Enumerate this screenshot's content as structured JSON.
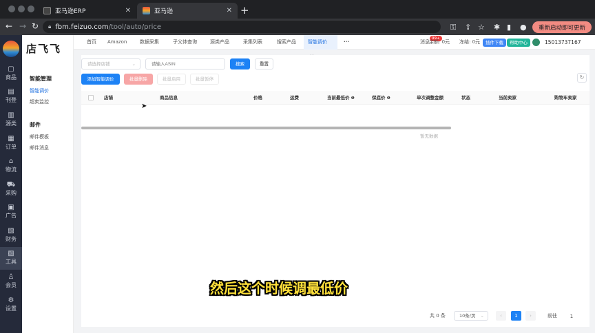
{
  "browser": {
    "tabs": [
      {
        "title": "亚马逊ERP",
        "active": false
      },
      {
        "title": "亚马逊",
        "active": true
      }
    ],
    "url_host": "fbm.feizuo.com",
    "url_path": "/tool/auto/price",
    "update_button": "重新启动即可更新"
  },
  "sidebar": {
    "items": [
      {
        "icon": "box-icon",
        "label": "商品"
      },
      {
        "icon": "profit-icon",
        "label": "刊登"
      },
      {
        "icon": "source-icon",
        "label": "源类"
      },
      {
        "icon": "order-icon",
        "label": "订单"
      },
      {
        "icon": "logistics-icon",
        "label": "物流"
      },
      {
        "icon": "cart-icon",
        "label": "采购"
      },
      {
        "icon": "ad-icon",
        "label": "广告"
      },
      {
        "icon": "finance-icon",
        "label": "财务"
      },
      {
        "icon": "tools-icon",
        "label": "工具"
      },
      {
        "icon": "member-icon",
        "label": "会员"
      },
      {
        "icon": "settings-icon",
        "label": "设置"
      }
    ]
  },
  "subpanel": {
    "brand": "店飞飞",
    "groups": [
      {
        "title": "智能管理",
        "items": [
          "智能调价",
          "超卖监控"
        ]
      },
      {
        "title": "邮件",
        "items": [
          "邮件模板",
          "邮件消息"
        ]
      }
    ]
  },
  "topnav": {
    "tabs": [
      "首页",
      "Amazon",
      "数据采集",
      "子父体查询",
      "源类产品",
      "采集列表",
      "搜索产品",
      "智能调价"
    ],
    "more": "···",
    "messages": "消息",
    "badge": "99+",
    "balance": "余额: 0元",
    "frozen": "冻结: 0元",
    "plugin_download": "插件下载",
    "help_center": "帮助中心",
    "phone": "15013737167"
  },
  "filters": {
    "store_placeholder": "请选择店铺",
    "asin_placeholder": "请输入ASIN",
    "search": "搜索",
    "reset": "重置"
  },
  "actions": {
    "add": "添加智能调价",
    "batch_delete": "批量删除",
    "batch_start": "批量启用",
    "batch_pause": "批量暂停"
  },
  "table": {
    "columns": [
      "店铺",
      "商品信息",
      "价格",
      "运费",
      "当前最低价",
      "保底价",
      "单次调整金额",
      "状态",
      "当前卖家",
      "购物车卖家"
    ],
    "empty_text": "暂无数据"
  },
  "pagination": {
    "total": "共 0 条",
    "page_size": "10条/页",
    "current_page": "1",
    "goto_label": "前往",
    "goto_value": "1"
  },
  "subtitle": "然后这个时候调最低价"
}
